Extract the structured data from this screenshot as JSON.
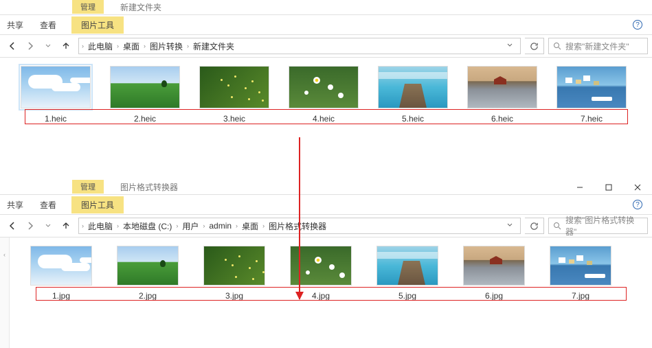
{
  "win1": {
    "mgmt": "管理",
    "folder_hint": "新建文件夹",
    "tabs": {
      "share": "共享",
      "view": "查看",
      "pictools": "图片工具"
    },
    "path": [
      "此电脑",
      "桌面",
      "图片转换",
      "新建文件夹"
    ],
    "search_placeholder": "搜索\"新建文件夹\"",
    "files": [
      {
        "name": "1.heic",
        "art": "sky"
      },
      {
        "name": "2.heic",
        "art": "field"
      },
      {
        "name": "3.heic",
        "art": "flower1"
      },
      {
        "name": "4.heic",
        "art": "flower2"
      },
      {
        "name": "5.heic",
        "art": "pier"
      },
      {
        "name": "6.heic",
        "art": "lakehouse"
      },
      {
        "name": "7.heic",
        "art": "harbor"
      }
    ]
  },
  "win2": {
    "mgmt": "管理",
    "folder_hint": "图片格式转换器",
    "tabs": {
      "share": "共享",
      "view": "查看",
      "pictools": "图片工具"
    },
    "path": [
      "此电脑",
      "本地磁盘 (C:)",
      "用户",
      "admin",
      "桌面",
      "图片格式转换器"
    ],
    "search_placeholder": "搜索\"图片格式转换器\"",
    "files": [
      {
        "name": "1.jpg",
        "art": "sky"
      },
      {
        "name": "2.jpg",
        "art": "field"
      },
      {
        "name": "3.jpg",
        "art": "flower1"
      },
      {
        "name": "4.jpg",
        "art": "flower2"
      },
      {
        "name": "5.jpg",
        "art": "pier"
      },
      {
        "name": "6.jpg",
        "art": "lakehouse"
      },
      {
        "name": "7.jpg",
        "art": "harbor"
      }
    ]
  }
}
